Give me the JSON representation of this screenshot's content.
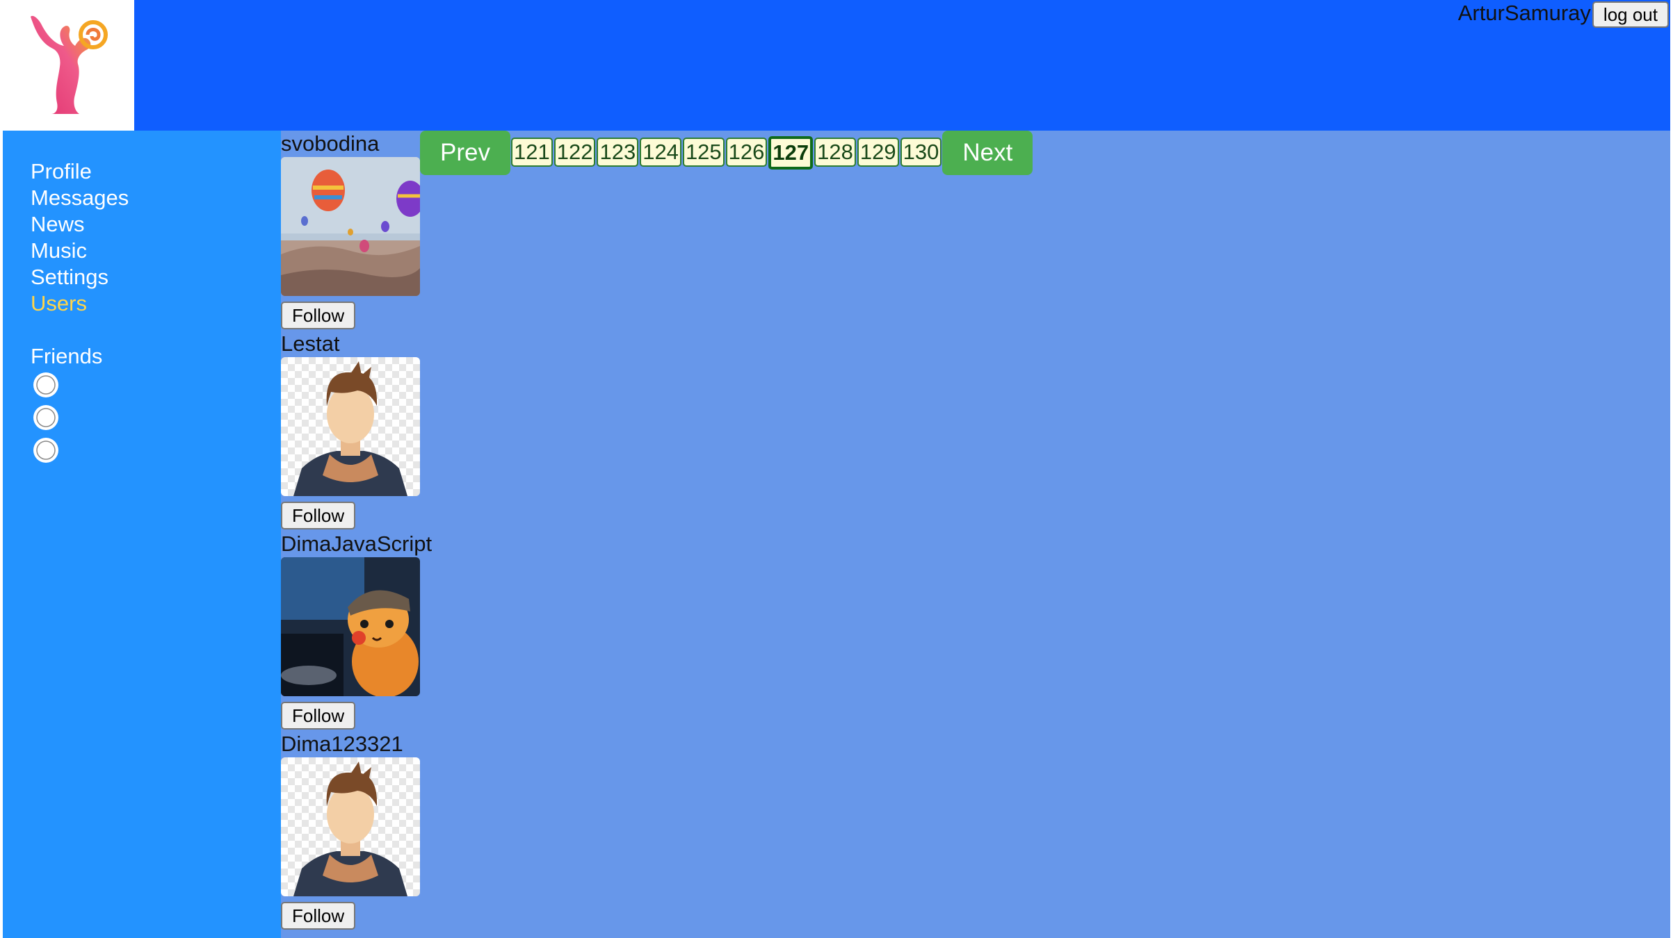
{
  "header": {
    "login_name": "ArturSamuray",
    "logout_label": "log out"
  },
  "sidebar": {
    "items": [
      {
        "label": "Profile",
        "active": false
      },
      {
        "label": "Messages",
        "active": false
      },
      {
        "label": "News",
        "active": false
      },
      {
        "label": "Music",
        "active": false
      },
      {
        "label": "Settings",
        "active": false
      },
      {
        "label": "Users",
        "active": true
      }
    ],
    "friends_title": "Friends",
    "friends_count": 3
  },
  "pagination": {
    "prev_label": "Prev",
    "next_label": "Next",
    "pages": [
      "121",
      "122",
      "123",
      "124",
      "125",
      "126",
      "127",
      "128",
      "129",
      "130"
    ],
    "current": "127"
  },
  "users": [
    {
      "name": "svobodina",
      "avatar": "balloons-photo",
      "follow_label": "Follow"
    },
    {
      "name": "Lestat",
      "avatar": "default-avatar",
      "follow_label": "Follow"
    },
    {
      "name": "DimaJavaScript",
      "avatar": "pikachu-photo",
      "follow_label": "Follow"
    },
    {
      "name": "Dima123321",
      "avatar": "default-avatar",
      "follow_label": "Follow"
    }
  ],
  "colors": {
    "header": "#0f5eff",
    "sidebar": "#2393ff",
    "content": "#6797ea",
    "active_nav": "#ffd54a",
    "pagination_button": "#4caf50"
  }
}
